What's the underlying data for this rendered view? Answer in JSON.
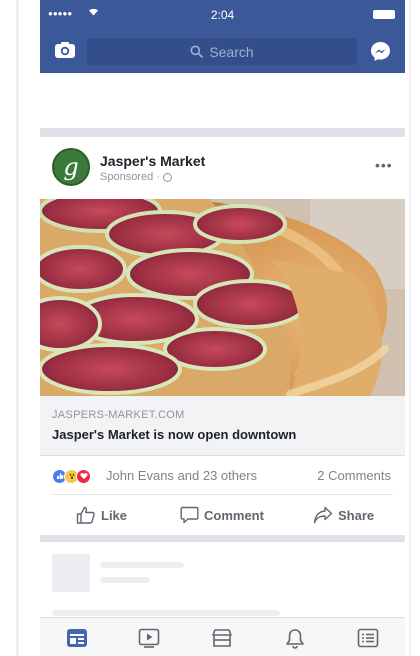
{
  "status_bar": {
    "signal": "●●●●●",
    "time": "2:04"
  },
  "nav": {
    "search_placeholder": "Search",
    "camera_icon": "camera-icon",
    "messenger_icon": "messenger-icon"
  },
  "post": {
    "page_name": "Jasper's Market",
    "avatar_letter": "g",
    "sponsored_label": "Sponsored ·",
    "more_label": "•••",
    "link_domain": "JASPERS-MARKET.COM",
    "link_headline": "Jasper's Market is now open downtown",
    "reactors": "John Evans and 23 others",
    "comments": "2 Comments",
    "actions": {
      "like": "Like",
      "comment": "Comment",
      "share": "Share"
    }
  },
  "tabs": [
    "news-feed-icon",
    "video-icon",
    "marketplace-icon",
    "notifications-icon",
    "menu-icon"
  ],
  "colors": {
    "brand": "#3b5998",
    "active_tab": "#4267b2",
    "inactive_tab": "#606770"
  }
}
